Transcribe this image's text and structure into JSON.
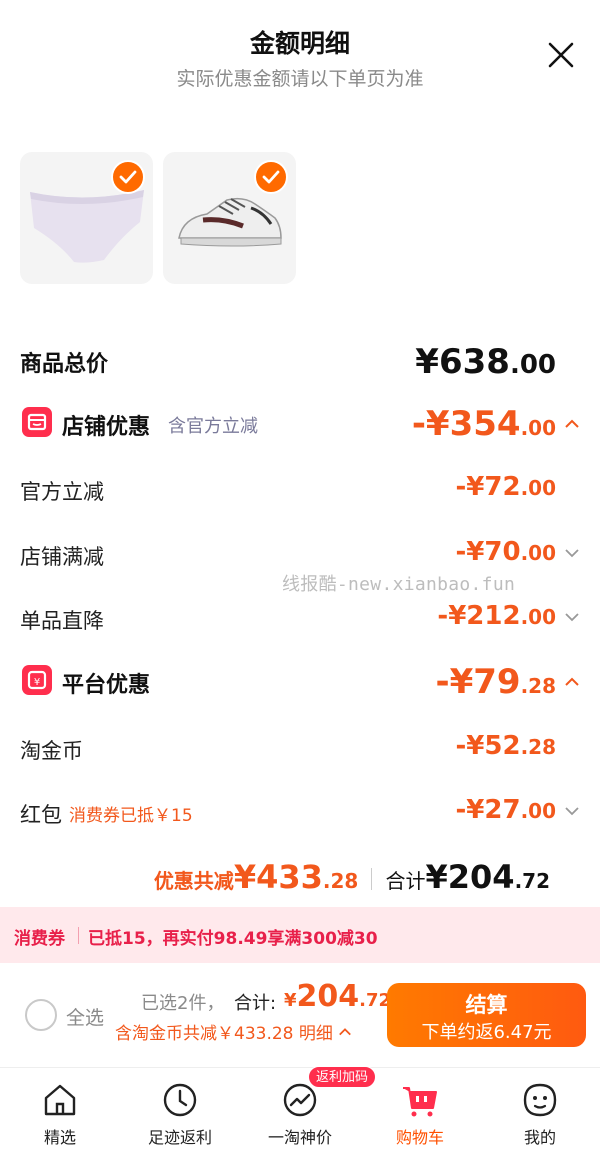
{
  "header": {
    "title": "金额明细",
    "subtitle": "实际优惠金额请以下单页为准"
  },
  "products": [
    {
      "name": "underwear-thumbnail",
      "selected": true
    },
    {
      "name": "sneaker-thumbnail",
      "selected": true
    }
  ],
  "breakdown": {
    "total_label": "商品总价",
    "total_int": "¥638",
    "total_dec": ".00",
    "store": {
      "label": "店铺优惠",
      "sub": "含官方立减",
      "int": "-¥354",
      "dec": ".00",
      "items": [
        {
          "label": "官方立减",
          "int": "-¥72",
          "dec": ".00",
          "expandable": false
        },
        {
          "label": "店铺满减",
          "int": "-¥70",
          "dec": ".00",
          "expandable": true
        },
        {
          "label": "单品直降",
          "int": "-¥212",
          "dec": ".00",
          "expandable": true
        }
      ]
    },
    "platform": {
      "label": "平台优惠",
      "int": "-¥79",
      "dec": ".28",
      "items": [
        {
          "label": "淘金币",
          "sub": "",
          "int": "-¥52",
          "dec": ".28",
          "expandable": false
        },
        {
          "label": "红包",
          "sub": "消费券已抵￥15",
          "int": "-¥27",
          "dec": ".00",
          "expandable": true
        }
      ]
    }
  },
  "summary": {
    "discount_label": "优惠共减",
    "discount_int": "¥433",
    "discount_dec": ".28",
    "total_label": "合计",
    "total_int": "¥204",
    "total_dec": ".72"
  },
  "watermark": "线报酷-new.xianbao.fun",
  "voucher": {
    "tag": "消费券",
    "text": "已抵15，再实付98.49享满300减30"
  },
  "checkout": {
    "select_all": "全选",
    "selected_count": "已选2件，",
    "total_label": "合计:",
    "total_yen": "¥",
    "total_int": "204",
    "total_dec": ".72",
    "coin_line": "含淘金币共减￥433.28  明细",
    "button_label": "结算",
    "button_sub": "下单约返6.47元"
  },
  "tabbar": {
    "items": [
      {
        "label": "精选",
        "icon": "home-icon",
        "active": false
      },
      {
        "label": "足迹返利",
        "icon": "clock-icon",
        "active": false
      },
      {
        "label": "一淘神价",
        "icon": "trend-icon",
        "active": false,
        "badge": "返利加码"
      },
      {
        "label": "购物车",
        "icon": "cart-icon",
        "active": true
      },
      {
        "label": "我的",
        "icon": "face-icon",
        "active": false
      }
    ]
  },
  "colors": {
    "accent": "#f2581c",
    "voucher_text": "#e8204a",
    "voucher_bg": "#ffe9ec",
    "section_icon": "#ff2e4d"
  }
}
